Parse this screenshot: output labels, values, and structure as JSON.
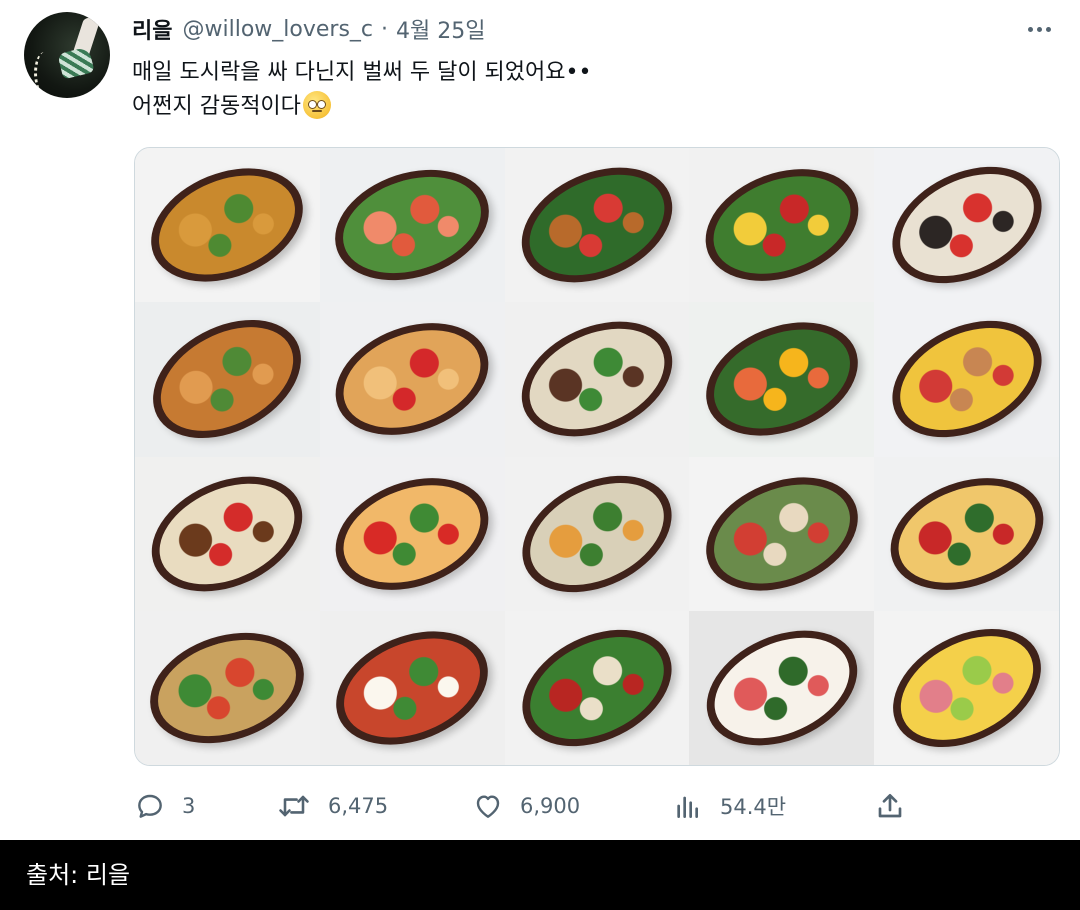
{
  "tweet": {
    "author_name": "리을",
    "handle": "@willow_lovers_c",
    "separator": "·",
    "date": "4월 25일",
    "text_line1": "매일 도시락을 싸 다닌지 벌써 두 달이 되었어요••",
    "text_line2": "어쩐지 감동적이다",
    "emoji": "face-with-rolling-eyes",
    "media": {
      "rows": 4,
      "columns": 5,
      "tiles": [
        {
          "bg": "#f3f3f3",
          "f1": "#c9892d",
          "f2": "#d99a3c",
          "f3": "#4e8a32"
        },
        {
          "bg": "#eef0f2",
          "f1": "#4f8f3b",
          "f2": "#f08a6a",
          "f3": "#e15a3d"
        },
        {
          "bg": "#f2f2f2",
          "f1": "#2f6b2a",
          "f2": "#b86a2b",
          "f3": "#d83a34"
        },
        {
          "bg": "#f1f1f1",
          "f1": "#3f7d2f",
          "f2": "#f2cc3a",
          "f3": "#c82828"
        },
        {
          "bg": "#f1f2f4",
          "f1": "#e9e1d2",
          "f2": "#2c2624",
          "f3": "#d8322e"
        },
        {
          "bg": "#eceeef",
          "f1": "#c67a32",
          "f2": "#e19b50",
          "f3": "#4f8a36"
        },
        {
          "bg": "#eff0f2",
          "f1": "#e1a459",
          "f2": "#f1c07a",
          "f3": "#d4282a"
        },
        {
          "bg": "#f0f0f0",
          "f1": "#e2d8c2",
          "f2": "#5a3424",
          "f3": "#3e8a36"
        },
        {
          "bg": "#eef1ef",
          "f1": "#356b2b",
          "f2": "#e86a3c",
          "f3": "#f6b51c"
        },
        {
          "bg": "#f1f2f4",
          "f1": "#f0c43d",
          "f2": "#d23a36",
          "f3": "#c88652"
        },
        {
          "bg": "#f0f0ef",
          "f1": "#e9dcc0",
          "f2": "#6b3a1c",
          "f3": "#d42c2a"
        },
        {
          "bg": "#f0f0f2",
          "f1": "#f1b869",
          "f2": "#d82a26",
          "f3": "#3f8a34"
        },
        {
          "bg": "#f1f1f1",
          "f1": "#d9d0b8",
          "f2": "#e59d3e",
          "f3": "#3d7f30"
        },
        {
          "bg": "#f3f3f3",
          "f1": "#6a8b4b",
          "f2": "#d23e33",
          "f3": "#e8d9c0"
        },
        {
          "bg": "#f0f1f2",
          "f1": "#f0c76b",
          "f2": "#c82828",
          "f3": "#2f6d2c"
        },
        {
          "bg": "#f0f0f0",
          "f1": "#c9a25f",
          "f2": "#3e8a35",
          "f3": "#d8462e"
        },
        {
          "bg": "#efefef",
          "f1": "#c8462c",
          "f2": "#fbf7ee",
          "f3": "#3f8a35"
        },
        {
          "bg": "#f2f2f2",
          "f1": "#3b7f30",
          "f2": "#b82622",
          "f3": "#eadfc8"
        },
        {
          "bg": "#e6e6e6",
          "f1": "#f7f2ea",
          "f2": "#e05a5a",
          "f3": "#2f6a2a"
        },
        {
          "bg": "#f3f3f3",
          "f1": "#f4d04a",
          "f2": "#e27f8a",
          "f3": "#9acb4a"
        }
      ]
    },
    "actions": {
      "reply_count": "3",
      "retweet_count": "6,475",
      "like_count": "6,900",
      "views_count": "54.4만"
    }
  },
  "footer": {
    "source_text": "출처: 리을"
  }
}
